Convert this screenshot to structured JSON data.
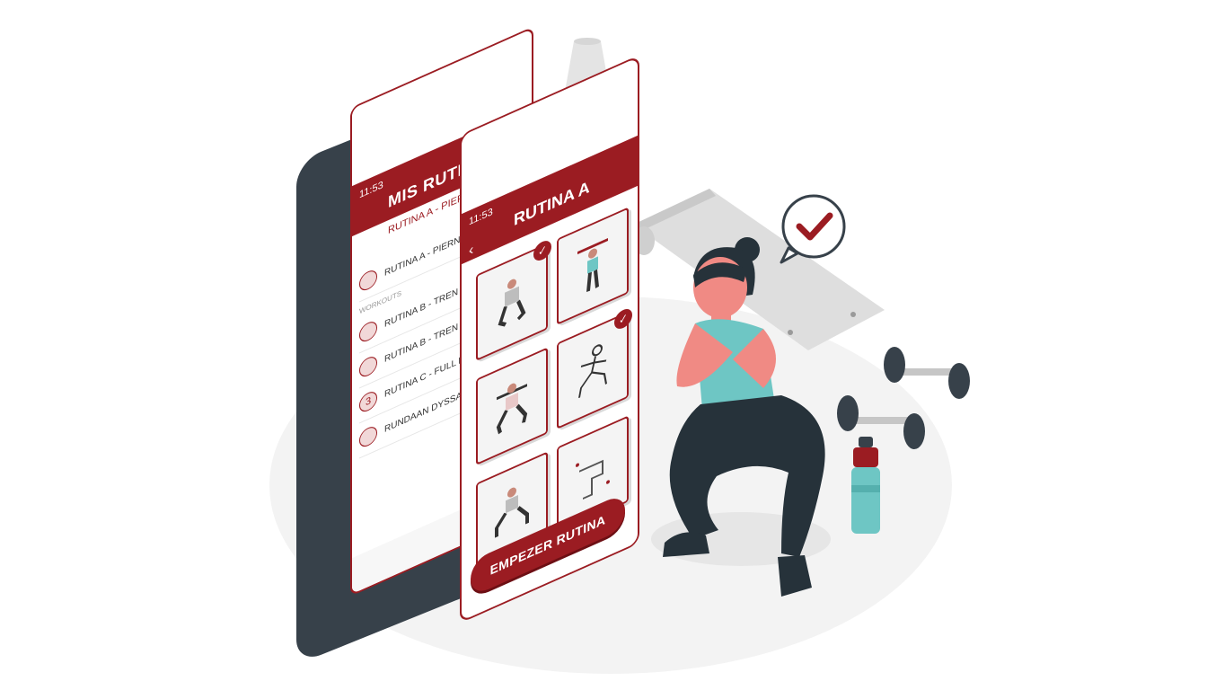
{
  "colors": {
    "brand": "#9b1c22",
    "phone_frame": "#37414a",
    "tile_bg": "#f4f4f4",
    "bottle": "#6ec6c4"
  },
  "phone_list": {
    "status_time": "11:53",
    "title": "MIS RUTINAS",
    "subtitle": "RUTINA A - PIERNA Y GLÚTO",
    "section_label": "WORKOUTS",
    "items": [
      {
        "avatar": "",
        "label": "RUTINA A - PIERNA"
      },
      {
        "avatar": "",
        "label": "RUTINA B - TREN SU"
      },
      {
        "avatar": "",
        "label": "RUTINA B - TREN SU"
      },
      {
        "avatar": "3",
        "label": "RUTINA C - FULL BO"
      },
      {
        "avatar": "",
        "label": "RUNDAAN DYSSAR"
      }
    ]
  },
  "phone_routine": {
    "status_time": "11:53",
    "title": "RUTINA A",
    "back_icon": "chevron-left-icon",
    "cta_label": "EMPEZER RUTINA",
    "exercises": [
      {
        "name": "squat",
        "checked": true
      },
      {
        "name": "overhead-press",
        "checked": false
      },
      {
        "name": "lunge",
        "checked": true
      },
      {
        "name": "weighted-squat",
        "checked": false
      },
      {
        "name": "side-squat",
        "checked": false
      },
      {
        "name": "step-up",
        "checked": false
      }
    ]
  },
  "decor": {
    "check_bubble_icon": "check-circle-icon",
    "lamp_icon": "lamp-icon",
    "mat_icon": "yoga-mat-icon",
    "dumbbell_icon": "dumbbell-icon",
    "bottle_icon": "water-bottle-icon"
  }
}
